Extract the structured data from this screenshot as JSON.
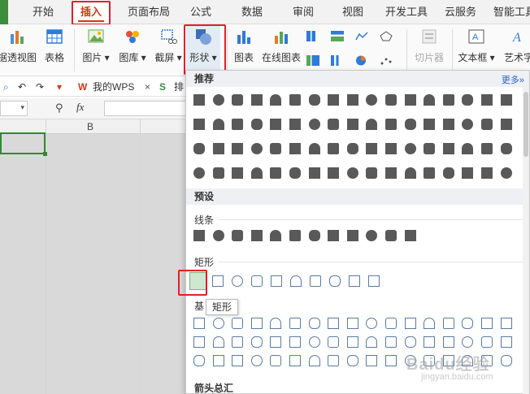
{
  "menu": {
    "tabs": [
      "开始",
      "插入",
      "页面布局",
      "公式",
      "数据",
      "审阅",
      "视图",
      "开发工具",
      "云服务",
      "智能工具"
    ],
    "active_tab": "插入"
  },
  "ribbon": {
    "pivot_view": "据透视图",
    "table": "表格",
    "picture": "图片",
    "gallery": "图库",
    "screenshot": "截屏",
    "shapes": "形状",
    "chart": "图表",
    "online_chart": "在线图表",
    "slicer": "切片器",
    "textbox": "文本框",
    "wordart": "艺术字"
  },
  "toolbar": {
    "doc_tab": "我的WPS",
    "doc_tab2": "排",
    "fx": "fx",
    "name_box": ""
  },
  "grid": {
    "col_b": "B"
  },
  "panel": {
    "recommended": "推荐",
    "more": "更多»",
    "presets": "预设",
    "lines": "线条",
    "rectangles": "矩形",
    "basic": "基",
    "arrows": "箭头总汇",
    "tooltip": "矩形"
  },
  "watermark": {
    "main": "Baidu经验",
    "sub": "jingyan.baidu.com"
  },
  "colors": {
    "accent_red": "#e0202a",
    "active_tab_text": "#d23a14",
    "selection_green": "#2f8a2f",
    "shape_gray": "#595959",
    "shape_outline": "#5a7ba6"
  }
}
